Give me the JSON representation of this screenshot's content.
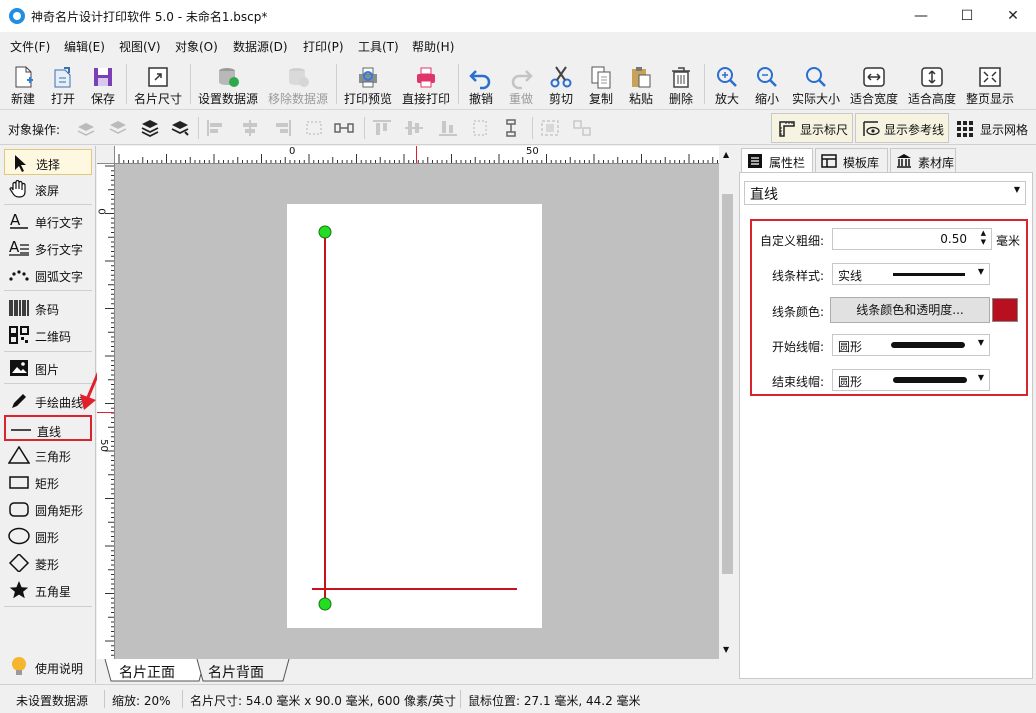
{
  "window": {
    "title": "神奇名片设计打印软件 5.0 - 未命名1.bscp*",
    "minimize": "—",
    "maximize": "☐",
    "close": "✕"
  },
  "menu": [
    "文件(F)",
    "编辑(E)",
    "视图(V)",
    "对象(O)",
    "数据源(D)",
    "打印(P)",
    "工具(T)",
    "帮助(H)"
  ],
  "toolbar": {
    "new": "新建",
    "open": "打开",
    "save": "保存",
    "card_size": "名片尺寸",
    "set_datasource": "设置数据源",
    "remove_datasource": "移除数据源",
    "print_preview": "打印预览",
    "print_direct": "直接打印",
    "undo": "撤销",
    "redo": "重做",
    "cut": "剪切",
    "copy": "复制",
    "paste": "粘贴",
    "delete": "删除",
    "zoom_in": "放大",
    "zoom_out": "缩小",
    "actual_size": "实际大小",
    "fit_width": "适合宽度",
    "fit_height": "适合高度",
    "fit_page": "整页显示"
  },
  "objbar": {
    "label": "对象操作:",
    "show_ruler": "显示标尺",
    "show_guides": "显示参考线",
    "show_grid": "显示网格"
  },
  "tools": {
    "select": "选择",
    "scroll": "滚屏",
    "single_text": "单行文字",
    "multi_text": "多行文字",
    "arc_text": "圆弧文字",
    "barcode": "条码",
    "qrcode": "二维码",
    "image": "图片",
    "freehand": "手绘曲线",
    "line": "直线",
    "triangle": "三角形",
    "rect": "矩形",
    "round_rect": "圆角矩形",
    "ellipse": "圆形",
    "diamond": "菱形",
    "star": "五角星",
    "help": "使用说明"
  },
  "ruler": {
    "top": [
      "0",
      "50"
    ],
    "left": [
      "0",
      "50"
    ]
  },
  "canvas_tabs": [
    "名片正面",
    "名片背面"
  ],
  "right_panel": {
    "tabs": [
      "属性栏",
      "模板库",
      "素材库"
    ],
    "object_type": "直线",
    "props": {
      "width_label": "自定义粗细:",
      "width_value": "0.50",
      "width_unit": "毫米",
      "style_label": "线条样式:",
      "style_value": "实线",
      "color_label": "线条颜色:",
      "color_button": "线条颜色和透明度...",
      "line_color": "#b8101e",
      "start_cap_label": "开始线帽:",
      "start_cap_value": "圆形",
      "end_cap_label": "结束线帽:",
      "end_cap_value": "圆形"
    }
  },
  "status": {
    "datasource": "未设置数据源",
    "zoom": "缩放: 20%",
    "card_size": "名片尺寸: 54.0 毫米 x 90.0 毫米, 600 像素/英寸",
    "mouse_pos": "鼠标位置: 27.1 毫米, 44.2 毫米"
  },
  "colors": {
    "accent_red": "#d9232e",
    "selected_line": "#c8101e",
    "handle_green": "#22dd22"
  }
}
